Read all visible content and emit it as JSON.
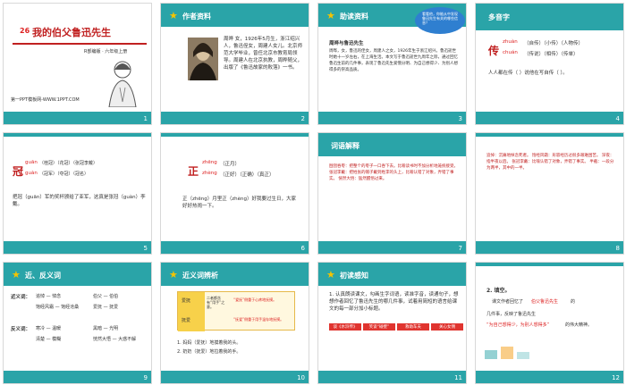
{
  "slides": [
    {
      "num": "1",
      "title_num": "26",
      "title": "我的伯父鲁迅先生",
      "edition": "R部编版 · 六年级上册",
      "footer": "第一PPT模板网-WWW.1PPT.COM"
    },
    {
      "num": "2",
      "heading": "作者资料",
      "body": "周晔 女，1926年5月生，浙江绍兴人，鲁迅侄女，周建人女儿。北京师范大学毕业，曾任北京市教育局领导。周建人在北京执教，周晔随父，出版了《鲁迅故家的败落》一书。"
    },
    {
      "num": "3",
      "heading": "助读资料",
      "bubble": "看看他，你能从中发现鲁迅先生有关的哪些信息？",
      "subheading": "周晔与鲁迅先生",
      "body": "周晔，女，鲁迅的侄女，周建人之女，1926年生于浙江绍兴。鲁迅逝世时她十一岁左右，在上海生活。本文写于鲁迅逝世九周年之际，通过回忆鲁迅生前的几件事，表现了鲁迅先生爱憎分明、为自己想得少、为别人想得多的崇高品质。"
    },
    {
      "num": "4",
      "heading": "多音字",
      "char": "传",
      "line1_pinyin": "zhuàn",
      "line1_words": "（自传）（小传）（人物传）",
      "line2_pinyin": "chuán",
      "line2_words": "（传说）（相传）（传单）",
      "sentence": "人人都在传（  ）说他在写自传（   ）。"
    },
    {
      "num": "5",
      "char": "冠",
      "line1_pinyin": "guān",
      "line1_words": "（桂冠）（花冠）（张冠李戴）",
      "line2_pinyin": "guàn",
      "line2_words": "（冠军）（夺冠）（冠名）",
      "sentence": "把冠（guān）军的奖杯颁给了亚军，这真是张冠（guàn）李戴。"
    },
    {
      "num": "6",
      "char": "正",
      "line1_pinyin": "zhēng",
      "line1_words": "（正月）",
      "line2_pinyin": "zhèng",
      "line2_words": "（正好）（正确）（真正）",
      "sentence": "正（zhēng）月里正（zhèng）好我要过生日，大家好好热闹一下。"
    },
    {
      "num": "7",
      "heading": "词语解释",
      "body": "囫囵吞枣：把整个的枣子一口吞下去。比喻读书时不加分析地笼统接受。 张冠李戴：把姓张的帽子戴到姓李的头上，比喻认错了对象，弄错了事实。 恍然大悟：猛然醒悟过来。"
    },
    {
      "num": "8",
      "body": "追悼：沉痛地悼念死者。 饱经风霜：形容经历过很多艰难困苦。 深夜：指半夜以后。 张冠李戴：比喻认错了对象，弄错了事实。 半截：一段分为两半，其中的一半。"
    },
    {
      "num": "9",
      "heading": "近、反义词",
      "label_syn": "近义词：",
      "syn": [
        "追悼 — 悼念",
        "伯父 — 伯伯",
        "饱经风霜 — 饱经沧桑",
        "爱抚 — 抚爱"
      ],
      "label_ant": "反义词：",
      "ant": [
        "寒冷 — 温暖",
        "黑暗 — 光明",
        "清楚 — 模糊",
        "恍然大悟 — 大惑不解"
      ]
    },
    {
      "num": "10",
      "heading": "近义词辨析",
      "col_a": "爱抚",
      "col_b": "抚爱",
      "row1": "二者都含有“用手”之意。",
      "row2a": "“爱抚”侧重于心疼地抚摸。",
      "row2b": "“抚爱”侧重于用手温存地抚摸。",
      "ex1": "1. 妈妈（爱抚）地摸着我的头。",
      "ex2": "2. 奶奶（抚爱）地拉着我的手。"
    },
    {
      "num": "11",
      "heading": "初读感知",
      "body": "1. 认真朗读课文，勾画生字词语，读准字音，读通句子，想想作者回忆了鲁迅先生的哪几件事，试着用简短的语言给课文的每一部分加小标题。",
      "tags": [
        "谈《水浒传》",
        "笑谈“碰壁”",
        "救助车夫",
        "关心女佣"
      ]
    },
    {
      "num": "12",
      "heading": "2. 填空。",
      "line1a": "课文作者回忆了",
      "line1b": "伯父鲁迅先生",
      "line1c": "的",
      "line2": "几件事，反映了鲁迅先生",
      "highlight": "“为自己想得少，为别人想得多”",
      "tail": "的伟大精神。"
    }
  ],
  "colors": {
    "teal": "#2aa4a8",
    "red": "#d62828",
    "yellow": "#f7d14a",
    "orange": "#f39c12",
    "tagred": "#e0342f"
  }
}
